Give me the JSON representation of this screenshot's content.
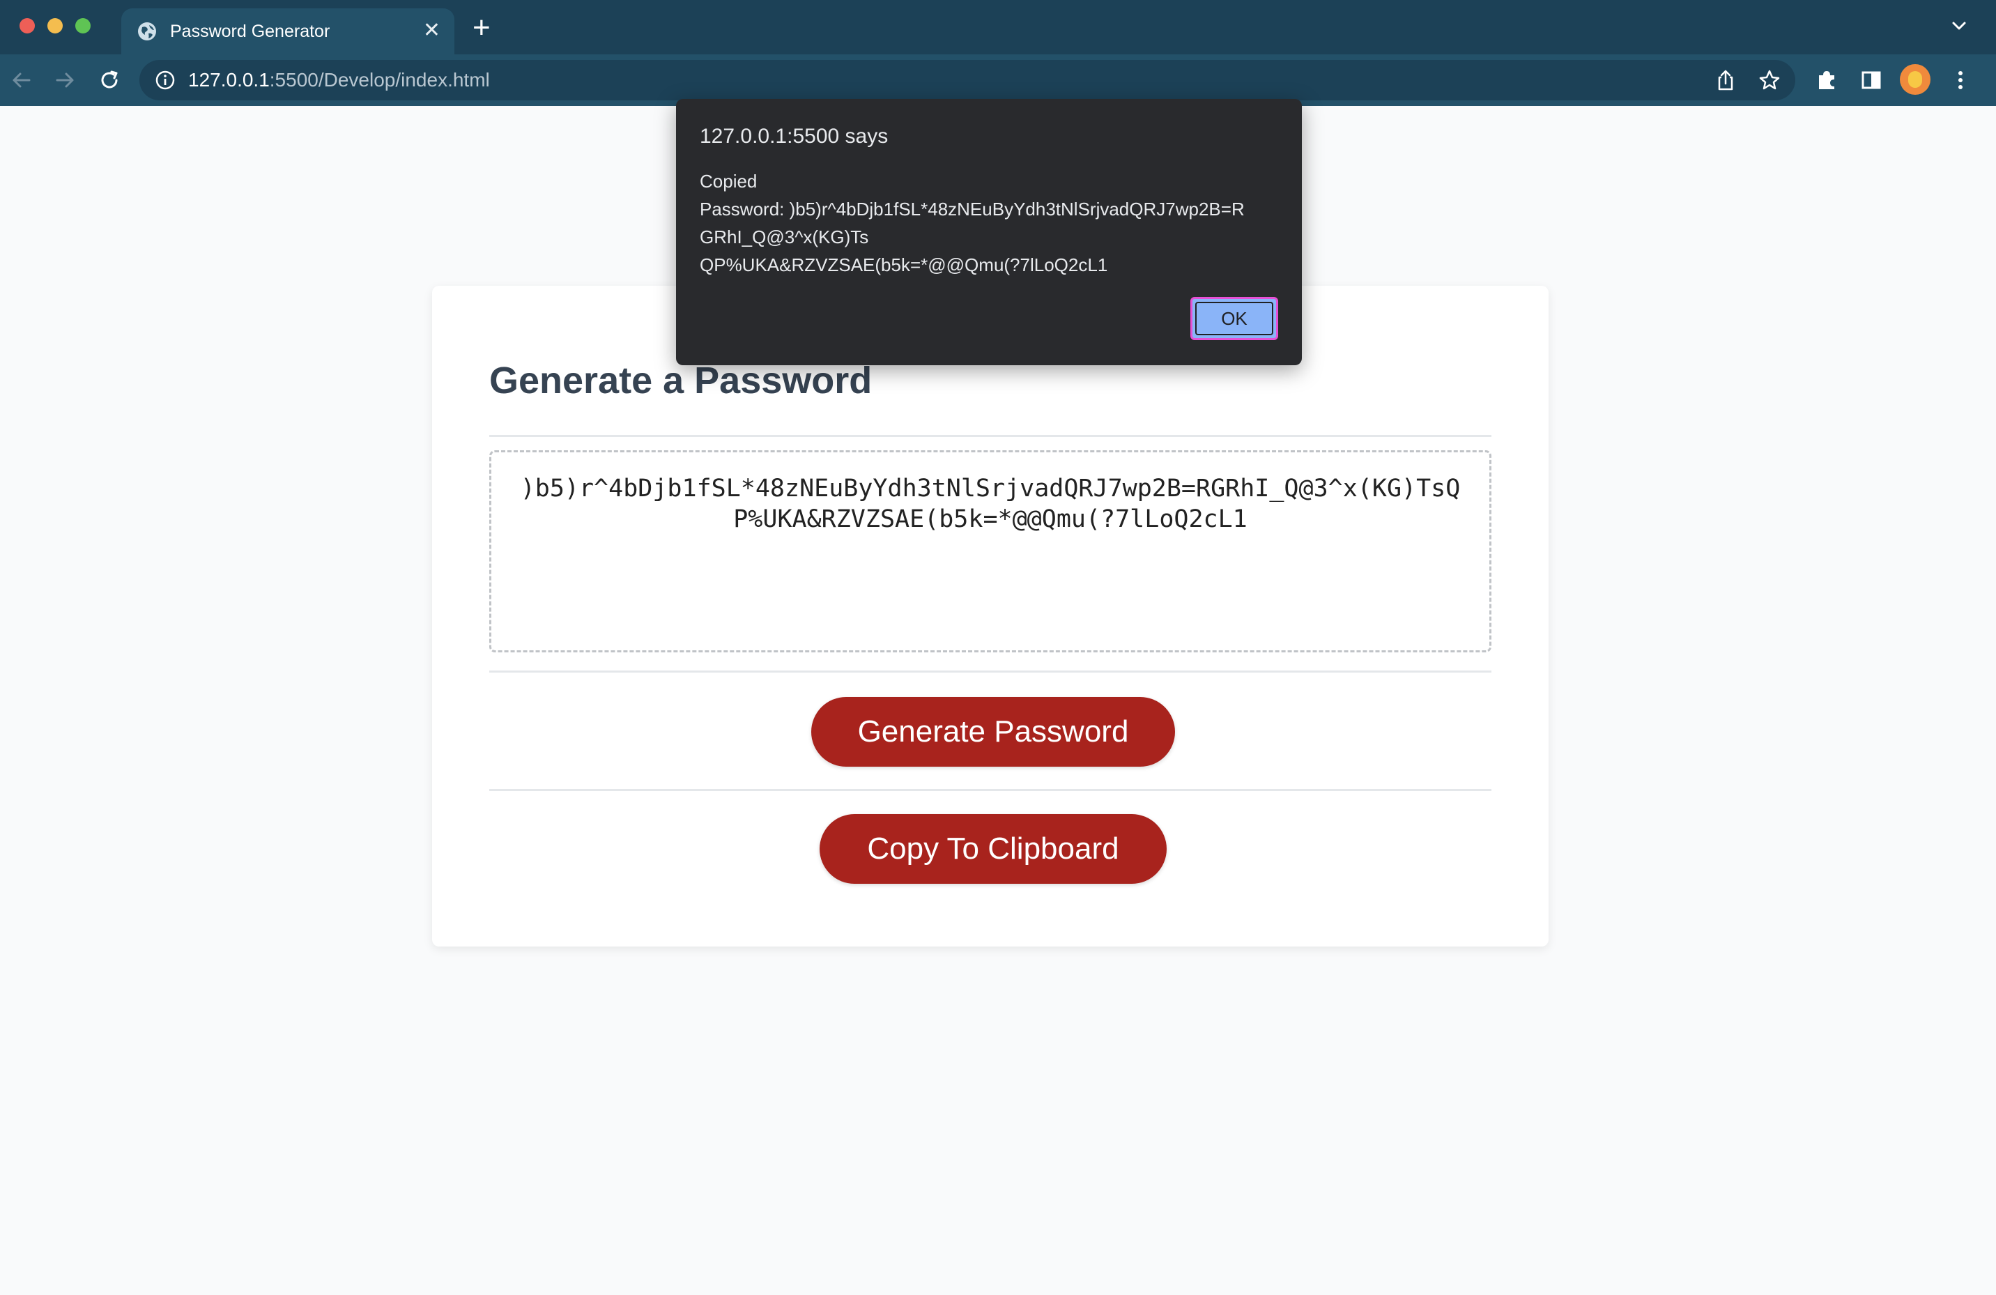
{
  "browser": {
    "tab_title": "Password Generator",
    "tab_close": "✕",
    "new_tab": "+",
    "url_host": "127.0.0.1",
    "url_rest": ":5500/Develop/index.html"
  },
  "page": {
    "title": "Generate a Password",
    "password": ")b5)r^4bDjb1fSL*48zNEuByYdh3tNlSrjvadQRJ7wp2B=RGRhI_Q@3^x(KG)TsQP%UKA&RZVZSAE(b5k=*@@Qmu(?7lLoQ2cL1",
    "generate_label": "Generate Password",
    "copy_label": "Copy To Clipboard"
  },
  "dialog": {
    "title": "127.0.0.1:5500 says",
    "message": "Copied\nPassword: )b5)r^4bDjb1fSL*48zNEuByYdh3tNlSrjvadQRJ7wp2B=R\nGRhI_Q@3^x(KG)Ts\nQP%UKA&RZVZSAE(b5k=*@@Qmu(?7lLoQ2cL1",
    "ok_label": "OK"
  },
  "colors": {
    "chrome_dark": "#1c4157",
    "chrome_toolbar": "#235169",
    "button_red": "#a8231d",
    "dialog_bg": "#292a2d",
    "ok_button": "#8ab4f8",
    "ok_focus_ring": "#e651d6"
  },
  "icons": {
    "back": "arrow-left-icon",
    "forward": "arrow-right-icon",
    "reload": "reload-icon",
    "info": "info-icon",
    "share": "share-icon",
    "bookmark": "star-icon",
    "extensions": "puzzle-icon",
    "sidebar": "side-panel-icon",
    "menu": "kebab-menu-icon",
    "tab_favicon": "globe-icon",
    "tab_list": "chevron-down-icon"
  }
}
